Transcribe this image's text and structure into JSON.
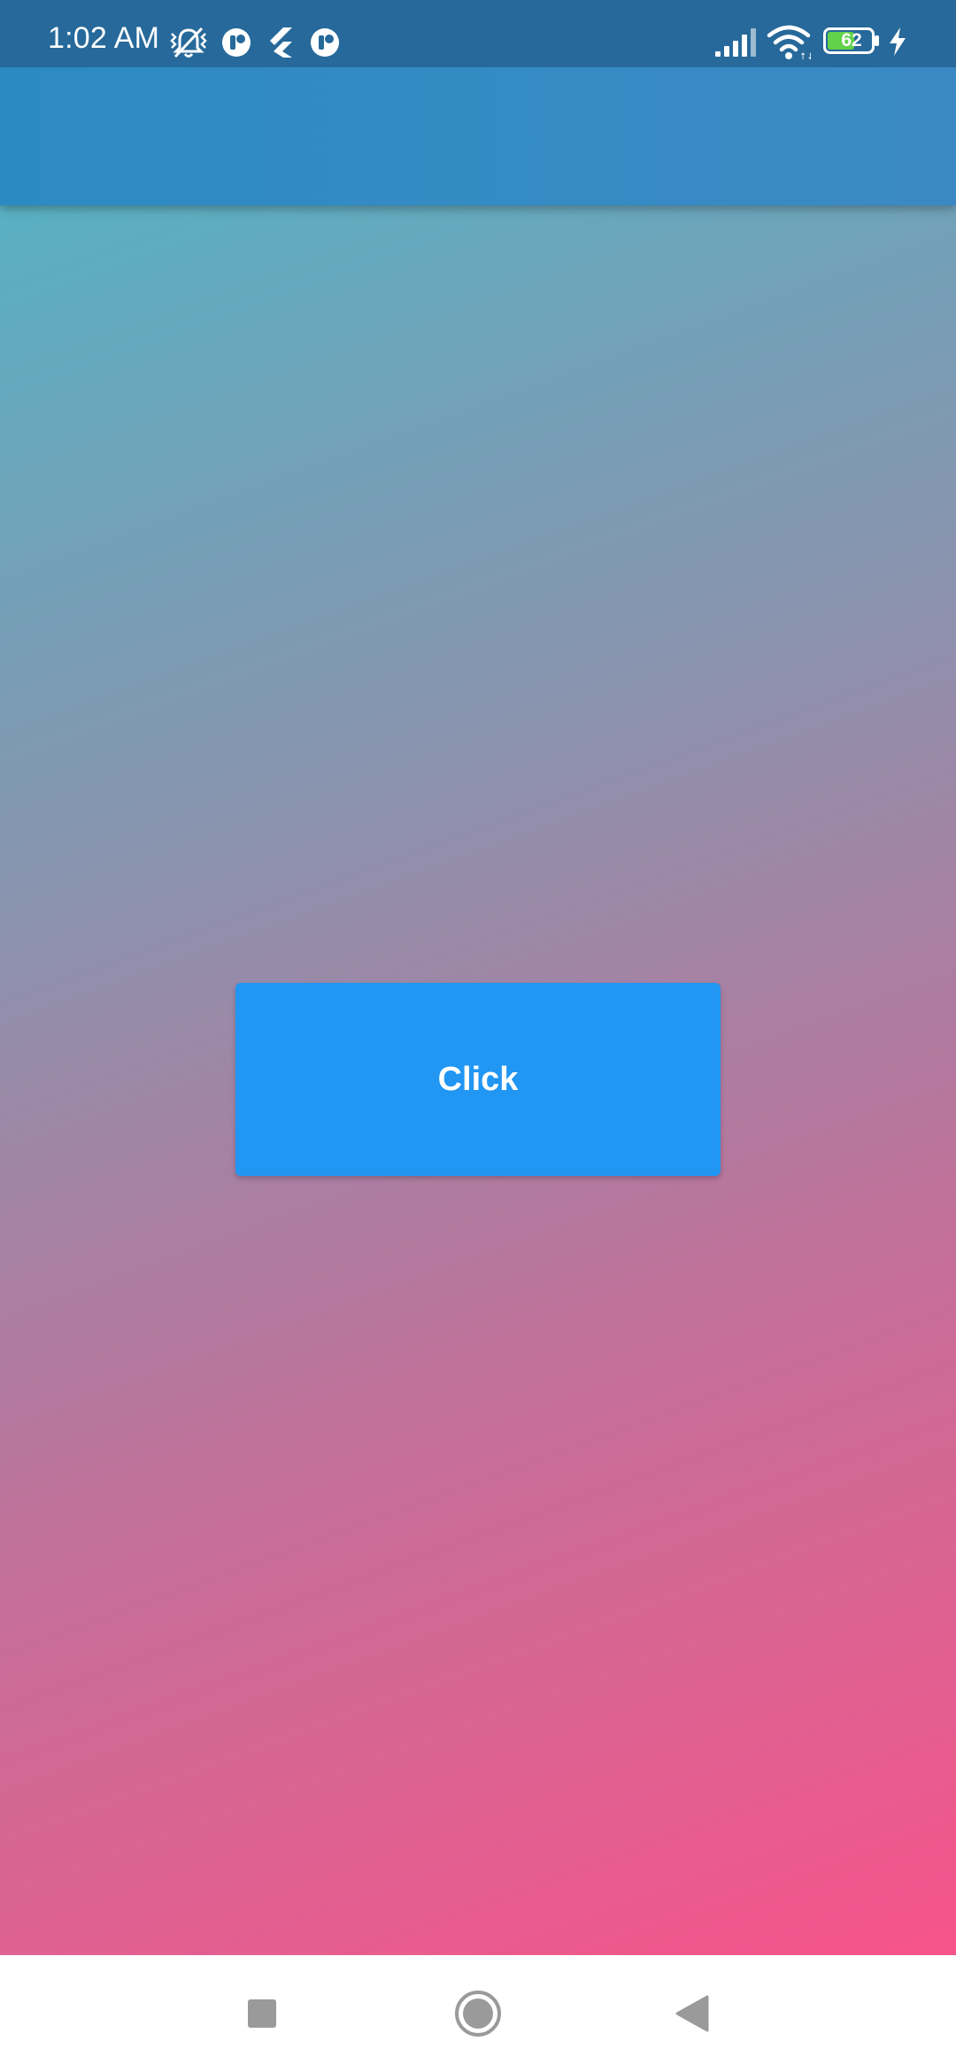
{
  "status_bar": {
    "time": "1:02 AM",
    "battery_level": "62",
    "left_icons": [
      "mute-vibrate-icon",
      "app-notification-icon",
      "flutter-icon",
      "app-notification-icon"
    ],
    "right_icons": [
      "cellular-signal-icon",
      "wifi-icon",
      "battery-icon",
      "charging-icon"
    ]
  },
  "main": {
    "button_label": "Click"
  },
  "colors": {
    "status_bar": "#26699a",
    "app_bar": "#348ac4",
    "button": "#2196f3",
    "gradient_top": "#4bb8c8",
    "gradient_bottom": "#f7548a"
  },
  "nav_bar": {
    "buttons": [
      "recents-square-icon",
      "home-circle-icon",
      "back-triangle-icon"
    ]
  }
}
